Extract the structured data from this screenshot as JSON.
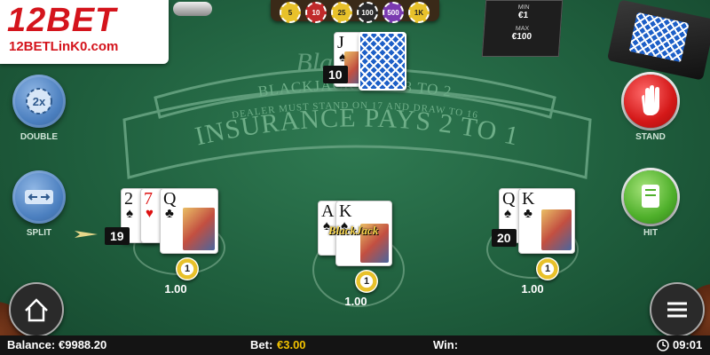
{
  "logo": {
    "brand": "12BET",
    "url": "12BETLinK0.com"
  },
  "felt": {
    "title": "BlackJack",
    "line1": "BLACKJACK PAYS 3 TO 2",
    "line2": "DEALER MUST STAND ON 17 AND DRAW TO 16",
    "insurance": "INSURANCE PAYS 2 TO 1"
  },
  "rail_chips": [
    {
      "label": "5",
      "color": "#e8c12a"
    },
    {
      "label": "10",
      "color": "#c02a2a"
    },
    {
      "label": "25",
      "color": "#e8c12a"
    },
    {
      "label": "100",
      "color": "#2a2a2a"
    },
    {
      "label": "500",
      "color": "#7a3ab0"
    },
    {
      "label": "1K",
      "color": "#e8c12a"
    }
  ],
  "limits": {
    "min_label": "MIN",
    "min_value": "€1",
    "max_label": "MAX",
    "max_value": "€100"
  },
  "controls": {
    "double": {
      "label": "DOUBLE",
      "icon": "2x"
    },
    "split": {
      "label": "SPLIT"
    },
    "stand": {
      "label": "STAND"
    },
    "hit": {
      "label": "HIT"
    }
  },
  "dealer": {
    "score": "10",
    "card": {
      "rank": "J",
      "suit": "♠",
      "color": "black"
    }
  },
  "hands": [
    {
      "score": "19",
      "cards": [
        {
          "rank": "2",
          "suit": "♠",
          "color": "black"
        },
        {
          "rank": "7",
          "suit": "♥",
          "color": "red"
        },
        {
          "rank": "Q",
          "suit": "♣",
          "color": "black"
        }
      ],
      "chip": "1",
      "bet": "1.00",
      "active": true
    },
    {
      "score": "",
      "badge": "BlackJack",
      "cards": [
        {
          "rank": "A",
          "suit": "♠",
          "color": "black"
        },
        {
          "rank": "K",
          "suit": "♠",
          "color": "black"
        }
      ],
      "chip": "1",
      "bet": "1.00"
    },
    {
      "score": "20",
      "cards": [
        {
          "rank": "Q",
          "suit": "♠",
          "color": "black"
        },
        {
          "rank": "K",
          "suit": "♣",
          "color": "black"
        }
      ],
      "chip": "1",
      "bet": "1.00"
    }
  ],
  "status_bar": {
    "balance_label": "Balance:",
    "balance_value": "€9988.20",
    "bet_label": "Bet:",
    "bet_value": "€3.00",
    "win_label": "Win:",
    "win_value": "",
    "clock": "09:01"
  }
}
